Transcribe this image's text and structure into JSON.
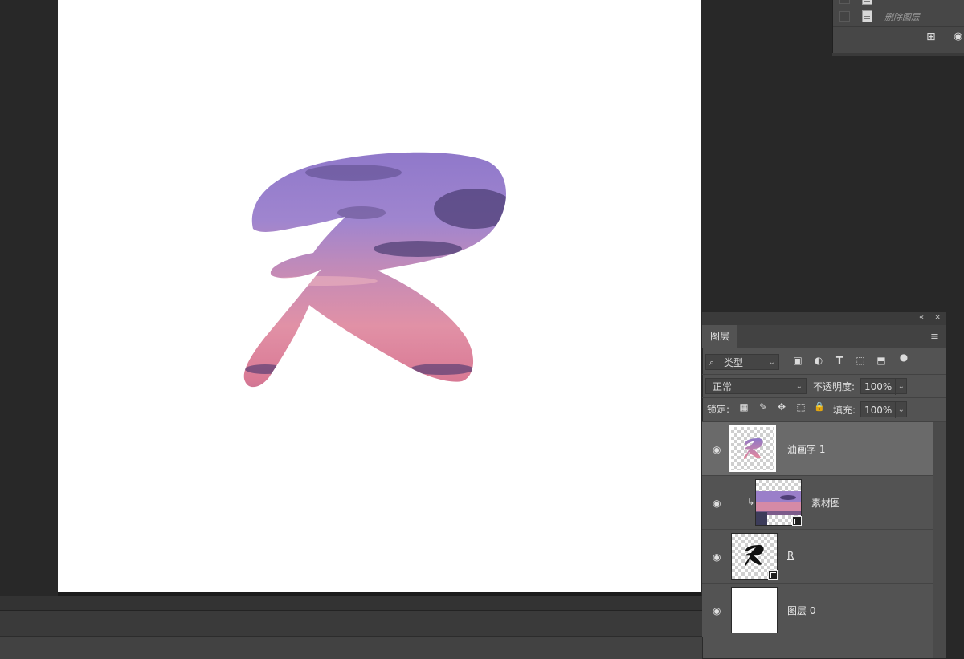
{
  "history_panel": {
    "items": [
      {
        "label": "删除图层",
        "icon": "document-icon"
      }
    ],
    "buttons": [
      {
        "name": "new-document-from-state-icon",
        "glyph": "⊞"
      },
      {
        "name": "new-snapshot-camera-icon",
        "glyph": "◉"
      }
    ]
  },
  "layers_panel": {
    "tab_label": "图层",
    "collapse_icon": "«",
    "close_icon": "×",
    "menu_icon": "≡",
    "filter": {
      "search_glyph": "⌕",
      "value": "类型",
      "icons": [
        {
          "name": "image-filter-icon",
          "glyph": "▣"
        },
        {
          "name": "adjustment-filter-icon",
          "glyph": "◐"
        },
        {
          "name": "type-filter-icon",
          "glyph": "T"
        },
        {
          "name": "shape-filter-icon",
          "glyph": "⬚"
        },
        {
          "name": "smart-object-filter-icon",
          "glyph": "⬒"
        },
        {
          "name": "filter-toggle-icon",
          "glyph": "●"
        }
      ]
    },
    "blend_mode": "正常",
    "opacity_label": "不透明度:",
    "opacity_value": "100%",
    "lock_label": "锁定:",
    "lock_icons": [
      {
        "name": "lock-transparent-pixels-icon",
        "glyph": "▦"
      },
      {
        "name": "lock-image-pixels-icon",
        "glyph": "✎"
      },
      {
        "name": "lock-position-icon",
        "glyph": "✥"
      },
      {
        "name": "lock-artboard-icon",
        "glyph": "⬚"
      },
      {
        "name": "lock-all-icon",
        "glyph": "🔒"
      }
    ],
    "fill_label": "填充:",
    "fill_value": "100%",
    "layers": [
      {
        "name": "油画字 1",
        "visible": true,
        "selected": true,
        "thumb": "r-gradient"
      },
      {
        "name": "素材图",
        "visible": true,
        "selected": false,
        "clipped": true,
        "thumb": "photo",
        "smart": true
      },
      {
        "name": "R",
        "visible": true,
        "selected": false,
        "thumb": "r-black",
        "smart": true
      },
      {
        "name": "图层 0",
        "visible": true,
        "selected": false,
        "thumb": "white"
      }
    ]
  },
  "colors": {
    "workspace_bg": "#282828",
    "panel_bg": "#535353",
    "selected_row": "#6a6a6a",
    "sky_top": "#8f78c8",
    "sky_mid": "#c88aa8",
    "sky_bottom": "#e8889a"
  }
}
